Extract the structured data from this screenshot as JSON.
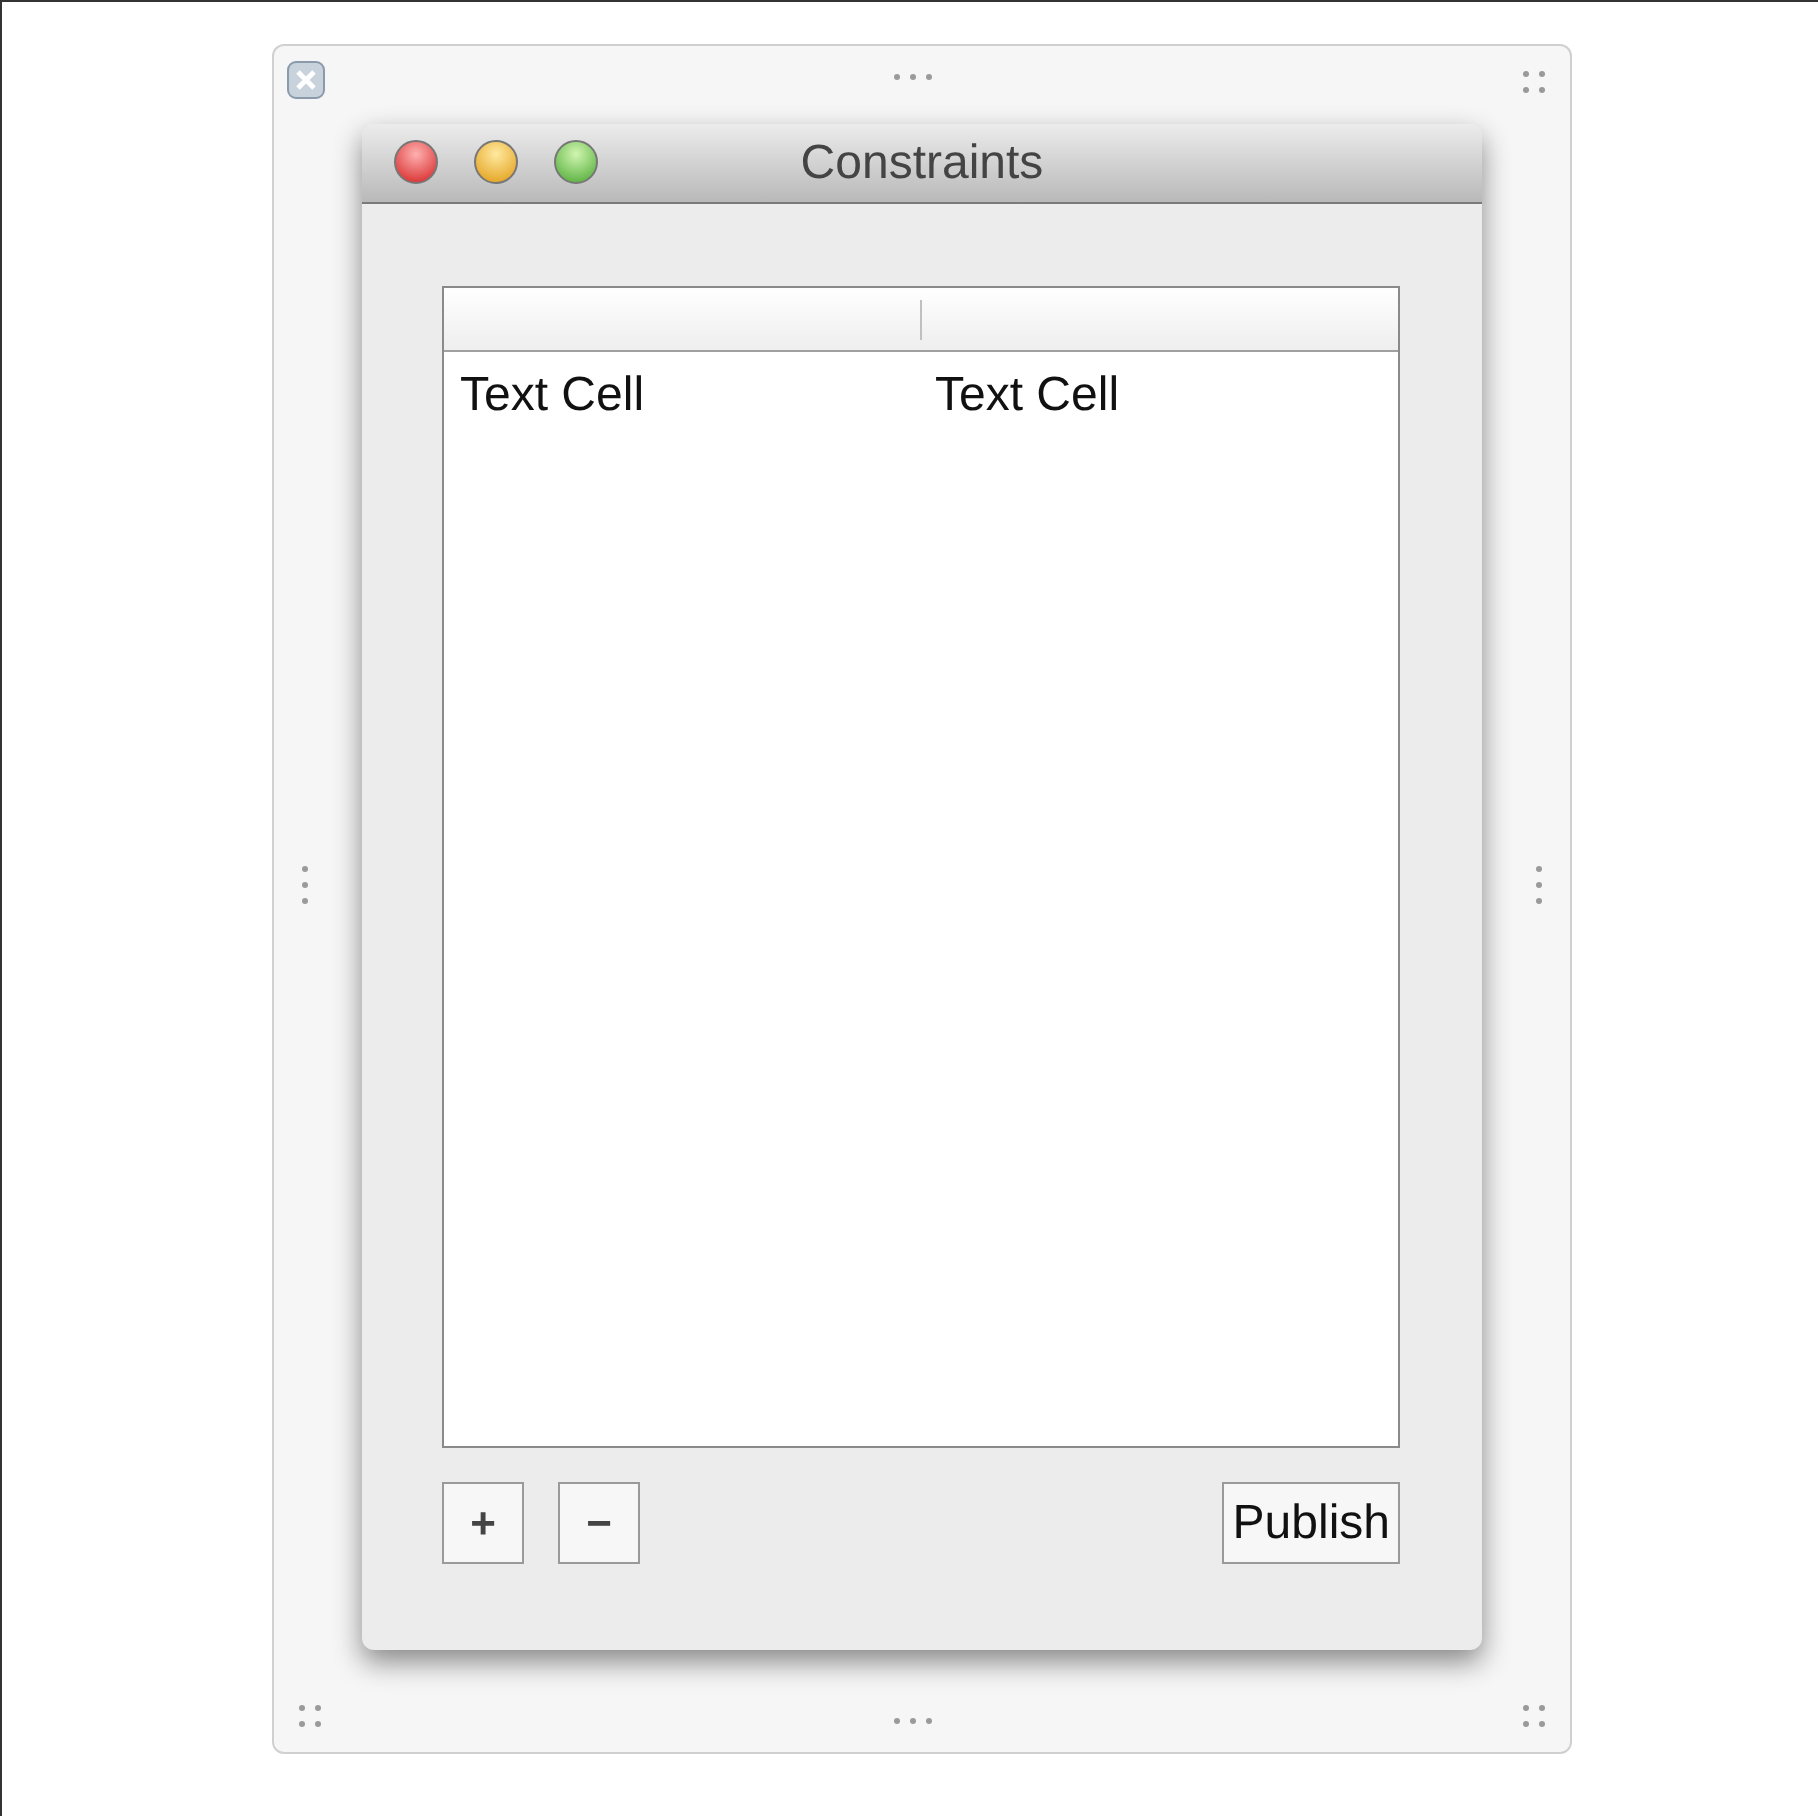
{
  "window": {
    "title": "Constraints"
  },
  "table": {
    "rows": [
      [
        "Text Cell",
        "Text Cell"
      ]
    ]
  },
  "buttons": [
    {
      "kind": "add",
      "label": "+"
    },
    {
      "kind": "remove",
      "label": "−"
    },
    {
      "kind": "action",
      "label": "Publish"
    }
  ]
}
